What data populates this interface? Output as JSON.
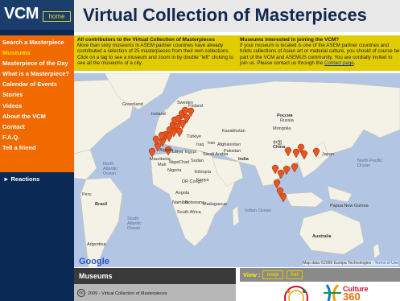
{
  "logo": {
    "text": "VCM",
    "home_label": "home"
  },
  "nav": {
    "items": [
      {
        "label": "Search a Masterpiece",
        "active": false
      },
      {
        "label": "Museums",
        "active": true
      },
      {
        "label": "Masterpiece of the Day",
        "active": false
      },
      {
        "label": "What is a Masterpiece?",
        "active": false
      },
      {
        "label": "Calendar of Events",
        "active": false
      },
      {
        "label": "Stories",
        "active": false
      },
      {
        "label": "Videos",
        "active": false
      },
      {
        "label": "About the VCM",
        "active": false
      },
      {
        "label": "Contact",
        "active": false
      },
      {
        "label": "F.A.Q.",
        "active": false
      },
      {
        "label": "Tell a friend",
        "active": false
      }
    ],
    "reactions_label": "► Reactions"
  },
  "header": {
    "title": "Virtual Collection of Masterpieces"
  },
  "info": {
    "left_heading": "All contributors to the Virtual Collection of Masterpieces",
    "left_text": "More than sixty museums in ASEM partner countries have already contributed a selection of 25 masterpieces from their own collections. Click on a tag to see a museum and zoom in by double \"left\" clicking to see all the museums of a city.",
    "right_heading": "Museums interested in joining the VCM?",
    "right_text": "If your museum is located is one of the ASEM partner countries and holds collections of Asian art or material culture, you should of course be part of the VCM and ASEMUS community. You are cordially invited to join us. Please contact us through the ",
    "right_link": "Contact page",
    "right_end": "."
  },
  "map": {
    "labels": {
      "greenland": "Greenland",
      "iceland": "Iceland",
      "finland": "Finland",
      "sweden": "Sweden",
      "russia": "Россия",
      "russia_sub": "Russia",
      "kazakhstan": "Kazakhstan",
      "mongolia": "Mongolia",
      "china": "China",
      "china_cn": "中国",
      "india": "India",
      "pakistan": "Pakistan",
      "afghanistan": "Afghanistan",
      "iran": "Iran",
      "iraq": "Iraq",
      "turkey": "Türkiye",
      "egypt": "Egypt",
      "libya": "Libya",
      "algeria": "Algeria",
      "mali": "Mali",
      "niger": "Niger",
      "nigeria": "Nigeria",
      "ethiopia": "Ethiopia",
      "kenya": "Kenya",
      "drc": "DR Congo",
      "angola": "Angola",
      "namibia": "Namibia",
      "botswana": "Botswana",
      "madagascar": "Madagascar",
      "south_africa": "South Africa",
      "brasil": "Brasil",
      "peru": "Peru",
      "argentina": "Argentina",
      "north_atlantic": "North Atlantic Ocean",
      "south_atlantic": "South Atlantic Ocean",
      "indian_ocean": "Indian Ocean",
      "north_pacific": "North Pacific Ocean",
      "australia": "Australia",
      "japan": "Japan",
      "saudi": "Saudi Arabia",
      "papua": "Papua New Guinea",
      "sudan": "Sudan",
      "chad": "Chad",
      "mauritania": "Mauritania"
    },
    "google_label": "Google",
    "credit": "Map data ©2009 Europa Technologies - ",
    "terms": "Terms of Use"
  },
  "museums_panel": {
    "title": "Museums",
    "cc": "cc",
    "copyright": "2009 - Virtual Collection of Masterpieces"
  },
  "view_panel": {
    "label": "View :",
    "map_label": "map",
    "list_label": "list",
    "culture_word": "Culture",
    "culture_num": "360"
  },
  "colors": {
    "nav_bg": "#f06a00",
    "sidebar_bg": "#0a2a55",
    "info_bg": "#e1cc00",
    "ocean": "#b2c5e2",
    "land": "#f4f2e7",
    "marker": "#e8551e",
    "title": "#13284f"
  }
}
